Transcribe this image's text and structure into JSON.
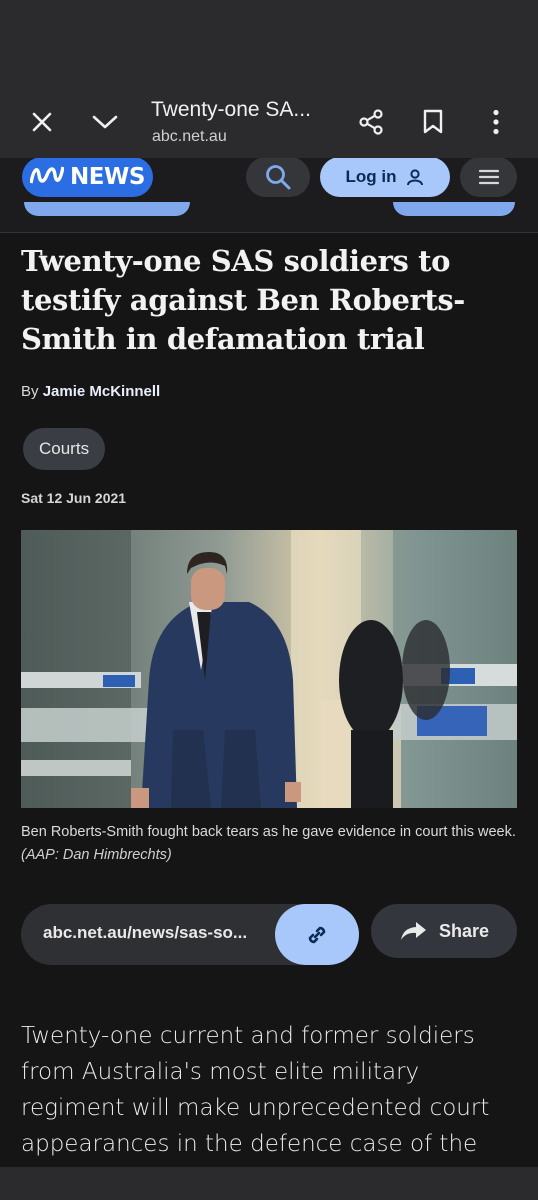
{
  "browser": {
    "tab_title": "Twenty-one SA...",
    "url": "abc.net.au",
    "icons": [
      "close-icon",
      "chevron-down-icon",
      "share-icon",
      "bookmark-icon",
      "more-vert-icon"
    ]
  },
  "site": {
    "logo_mark": "ABC",
    "logo_word": "NEWS",
    "login_label": "Log in",
    "colors": {
      "brand": "#2b6de2",
      "accent": "#a8c7fa"
    }
  },
  "article": {
    "headline": "Twenty-one SAS soldiers to testify against Ben Roberts-Smith in defamation trial",
    "byline_prefix": "By",
    "author": "Jamie McKinnell",
    "tag": "Courts",
    "date": "Sat 12 Jun 2021",
    "caption": "Ben Roberts-Smith fought back tears as he gave evidence in court this week.",
    "caption_credit": "(AAP: Dan Himbrechts)",
    "share_url": "abc.net.au/news/sas-so...",
    "share_label": "Share",
    "body": "Twenty-one current and former soldiers from Australia's most elite military regiment will make unprecedented court appearances in the defence case of the"
  }
}
